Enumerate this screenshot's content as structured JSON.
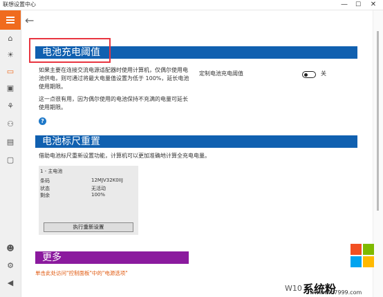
{
  "window": {
    "title": "联想设置中心",
    "minimize": "—",
    "maximize": "☐",
    "close": "✕"
  },
  "sidebar": {
    "menu_icon": "hamburger-icon",
    "items": [
      {
        "icon": "home-icon"
      },
      {
        "icon": "bulb-icon"
      },
      {
        "icon": "battery-icon"
      },
      {
        "icon": "camera-icon"
      },
      {
        "icon": "network-icon"
      },
      {
        "icon": "devices-icon"
      },
      {
        "icon": "media-icon"
      },
      {
        "icon": "display-icon"
      }
    ],
    "bottom_items": [
      {
        "icon": "user-icon"
      },
      {
        "icon": "settings-icon"
      },
      {
        "icon": "megaphone-icon"
      }
    ]
  },
  "main": {
    "threshold": {
      "header": "电池充电阈值",
      "description": "如果主要在连接交流电源适配器时使用计算机，仅偶尔使用电池供电，则可通过将最大电量值设置为低于 100%，延长电池使用期限。",
      "note": "这一点很有用，因为偶尔使用的电池保持不充满的电量可延长使用期限。",
      "toggle_label": "定制电池充电阈值",
      "toggle_state": "关"
    },
    "gauge_reset": {
      "header": "电池标尺重置",
      "description": "借助电池标尺重新设置功能，计算机可以更加准确地计算全充电电量。",
      "battery": {
        "title": "1 - 主电池",
        "rows": [
          {
            "label": "条码",
            "value": "12MJV32K0IIJ"
          },
          {
            "label": "状态",
            "value": "无活动"
          },
          {
            "label": "剩余",
            "value": "100%"
          }
        ]
      },
      "button": "执行重新设置"
    },
    "more": {
      "header": "更多",
      "link": "单击此处访问\"控制面板\"中的\"电源选项\""
    }
  },
  "watermark": {
    "text": "系统粉",
    "url": "www.win7999.com",
    "overlay": "W10"
  }
}
